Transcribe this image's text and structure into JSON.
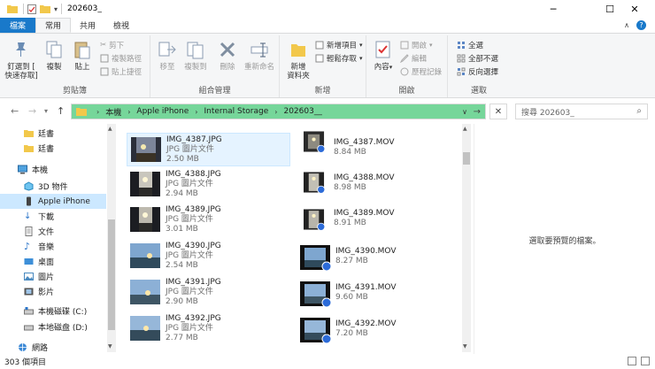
{
  "titlebar": {
    "title": "202603_",
    "minimize": "─",
    "maximize": "☐",
    "close": "✕"
  },
  "tabs": {
    "file": "檔案",
    "home": "常用",
    "share": "共用",
    "view": "檢視"
  },
  "ribbon": {
    "clipboard": {
      "label": "剪貼簿",
      "pin": "釘選到 [\n快速存取]",
      "copy": "複製",
      "paste": "貼上",
      "cut": "剪下",
      "copy_path": "複製路徑",
      "paste_shortcut": "貼上捷徑"
    },
    "organize": {
      "label": "組合管理",
      "move_to": "移至",
      "copy_to": "複製到",
      "delete": "刪除",
      "rename": "重新命名"
    },
    "new": {
      "label": "新增",
      "new_folder": "新增\n資料夾",
      "new_item": "新增項目",
      "easy_access": "輕鬆存取"
    },
    "open": {
      "label": "開啟",
      "properties": "內容",
      "open": "開啟",
      "edit": "編輯",
      "history": "歷程記錄"
    },
    "select": {
      "label": "選取",
      "select_all": "全選",
      "select_none": "全部不選",
      "invert": "反向選擇"
    }
  },
  "address": {
    "crumbs": [
      "本機",
      "Apple iPhone",
      "Internal Storage",
      "202603__"
    ],
    "search_placeholder": "搜尋 202603_"
  },
  "nav": {
    "items": [
      {
        "label": "廷書"
      },
      {
        "label": "廷書"
      },
      {
        "label": "本機"
      },
      {
        "label": "3D 物件"
      },
      {
        "label": "Apple iPhone"
      },
      {
        "label": "下載"
      },
      {
        "label": "文件"
      },
      {
        "label": "音樂"
      },
      {
        "label": "桌面"
      },
      {
        "label": "圖片"
      },
      {
        "label": "影片"
      },
      {
        "label": "本機磁碟 (C:)"
      },
      {
        "label": "本地磁盘 (D:)"
      },
      {
        "label": "網路"
      }
    ]
  },
  "files": {
    "jpg_type": "JPG 圖片文件",
    "left": [
      {
        "name": "IMG_4387.JPG",
        "size": "2.50 MB"
      },
      {
        "name": "IMG_4388.JPG",
        "size": "2.94 MB"
      },
      {
        "name": "IMG_4389.JPG",
        "size": "3.01 MB"
      },
      {
        "name": "IMG_4390.JPG",
        "size": "2.54 MB"
      },
      {
        "name": "IMG_4391.JPG",
        "size": "2.90 MB"
      },
      {
        "name": "IMG_4392.JPG",
        "size": "2.77 MB"
      }
    ],
    "right": [
      {
        "name": "IMG_4387.MOV",
        "size": "8.84 MB"
      },
      {
        "name": "IMG_4388.MOV",
        "size": "8.98 MB"
      },
      {
        "name": "IMG_4389.MOV",
        "size": "8.91 MB"
      },
      {
        "name": "IMG_4390.MOV",
        "size": "8.27 MB"
      },
      {
        "name": "IMG_4391.MOV",
        "size": "9.60 MB"
      },
      {
        "name": "IMG_4392.MOV",
        "size": "7.20 MB"
      }
    ]
  },
  "preview": {
    "message": "選取要預覽的檔案。"
  },
  "status": {
    "count": "303 個項目"
  },
  "colors": {
    "accent": "#1979ca",
    "address_highlight": "#76d69a",
    "selected_nav": "#cce8ff"
  }
}
